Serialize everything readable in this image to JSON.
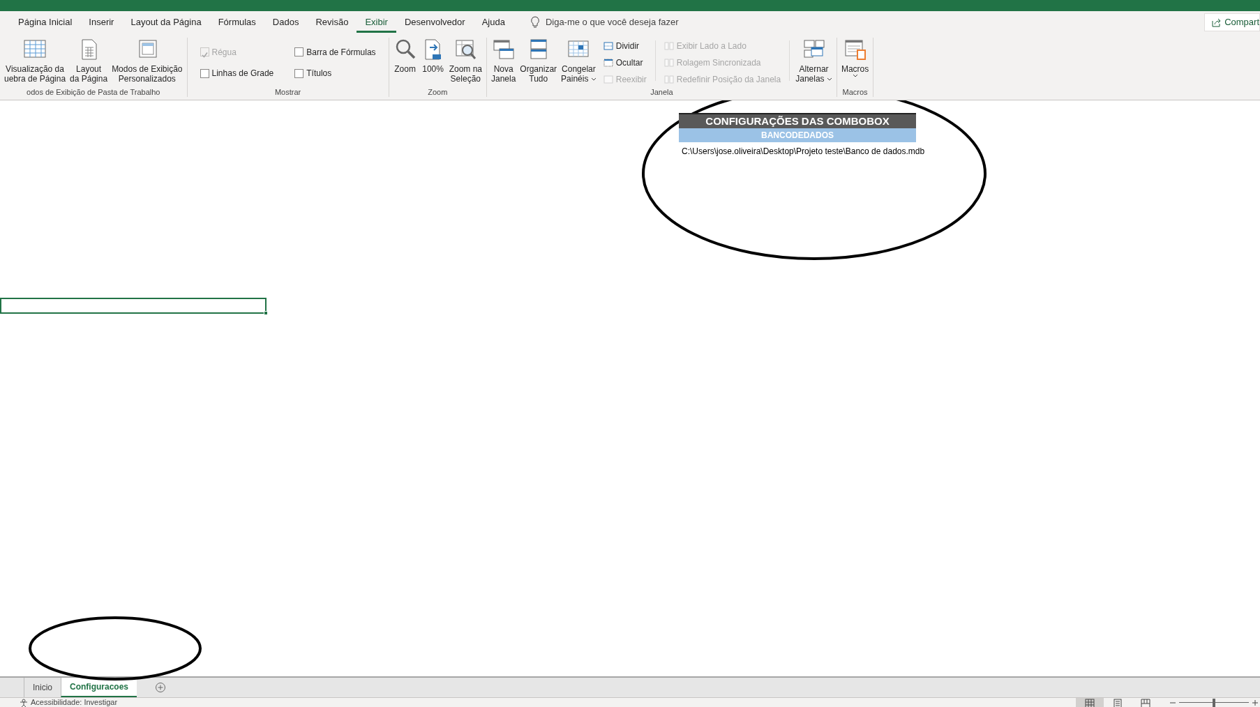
{
  "menu_tabs": [
    {
      "label": "Página Inicial",
      "selected": false
    },
    {
      "label": "Inserir",
      "selected": false
    },
    {
      "label": "Layout da Página",
      "selected": false
    },
    {
      "label": "Fórmulas",
      "selected": false
    },
    {
      "label": "Dados",
      "selected": false
    },
    {
      "label": "Revisão",
      "selected": false
    },
    {
      "label": "Exibir",
      "selected": true
    },
    {
      "label": "Desenvolvedor",
      "selected": false
    },
    {
      "label": "Ajuda",
      "selected": false
    }
  ],
  "tell_me": {
    "placeholder": "Diga-me o que você deseja fazer"
  },
  "share_button": "Compart",
  "ribbon_groups": [
    {
      "label": "odos de Exibição de Pasta de Trabalho",
      "items": [
        {
          "kind": "large",
          "lines": [
            "Visualização da",
            "uebra de Página"
          ],
          "dropdown": false
        },
        {
          "kind": "large",
          "lines": [
            "Layout",
            "da Página"
          ],
          "dropdown": false
        },
        {
          "kind": "large",
          "lines": [
            "Modos de Exibição",
            "Personalizados"
          ],
          "dropdown": false
        }
      ]
    },
    {
      "label": "Mostrar",
      "items": [
        {
          "kind": "stack",
          "items": [
            {
              "kind": "checkbox",
              "label": "Régua",
              "checked": true,
              "disabled": true
            },
            {
              "kind": "checkbox",
              "label": "Linhas de Grade",
              "checked": false,
              "disabled": false
            }
          ]
        },
        {
          "kind": "stack",
          "items": [
            {
              "kind": "checkbox",
              "label": "Barra de Fórmulas",
              "checked": false,
              "disabled": false
            },
            {
              "kind": "checkbox",
              "label": "Títulos",
              "checked": false,
              "disabled": false
            }
          ]
        }
      ]
    },
    {
      "label": "Zoom",
      "items": [
        {
          "kind": "large",
          "lines": [
            "Zoom"
          ],
          "dropdown": false
        },
        {
          "kind": "large",
          "lines": [
            "100%"
          ],
          "dropdown": false
        },
        {
          "kind": "large",
          "lines": [
            "Zoom na",
            "Seleção"
          ],
          "dropdown": false
        }
      ]
    },
    {
      "label": "Janela",
      "items": [
        {
          "kind": "large",
          "lines": [
            "Nova",
            "Janela"
          ],
          "dropdown": false
        },
        {
          "kind": "large",
          "lines": [
            "Organizar",
            "Tudo"
          ],
          "dropdown": false
        },
        {
          "kind": "large",
          "lines": [
            "Congelar",
            "Painéis"
          ],
          "dropdown": true
        },
        {
          "kind": "stack",
          "items": [
            {
              "kind": "small",
              "label": "Dividir",
              "disabled": false
            },
            {
              "kind": "small",
              "label": "Ocultar",
              "disabled": false
            },
            {
              "kind": "small",
              "label": "Reexibir",
              "disabled": true
            }
          ]
        },
        {
          "kind": "separator"
        },
        {
          "kind": "stack",
          "items": [
            {
              "kind": "small",
              "label": "Exibir Lado a Lado",
              "disabled": true
            },
            {
              "kind": "small",
              "label": "Rolagem Sincronizada",
              "disabled": true
            },
            {
              "kind": "small",
              "label": "Redefinir Posição da Janela",
              "disabled": true
            }
          ]
        },
        {
          "kind": "separator"
        },
        {
          "kind": "large",
          "lines": [
            "Alternar",
            "Janelas"
          ],
          "dropdown": true
        }
      ]
    },
    {
      "label": "Macros",
      "items": [
        {
          "kind": "large",
          "lines": [
            "Macros"
          ],
          "dropdown": true
        }
      ]
    }
  ],
  "sheet": {
    "title": "CONFIGURAÇÕES DAS COMBOBOX",
    "header": "BANCODEDADOS",
    "value": "C:\\Users\\jose.oliveira\\Desktop\\Projeto teste\\Banco de dados.mdb",
    "active_cell": true
  },
  "annotations": [
    {
      "kind": "ellipse"
    },
    {
      "kind": "ellipse"
    }
  ],
  "sheet_tabs": [
    {
      "label": "Inicio",
      "selected": false
    },
    {
      "label": "Configuracoes",
      "selected": true
    }
  ],
  "status_bar": {
    "text": "Acessibilidade: Investigar",
    "views": [
      {
        "selected": true
      },
      {
        "selected": false
      },
      {
        "selected": false
      }
    ],
    "zoom": {
      "level": 0.5
    }
  }
}
